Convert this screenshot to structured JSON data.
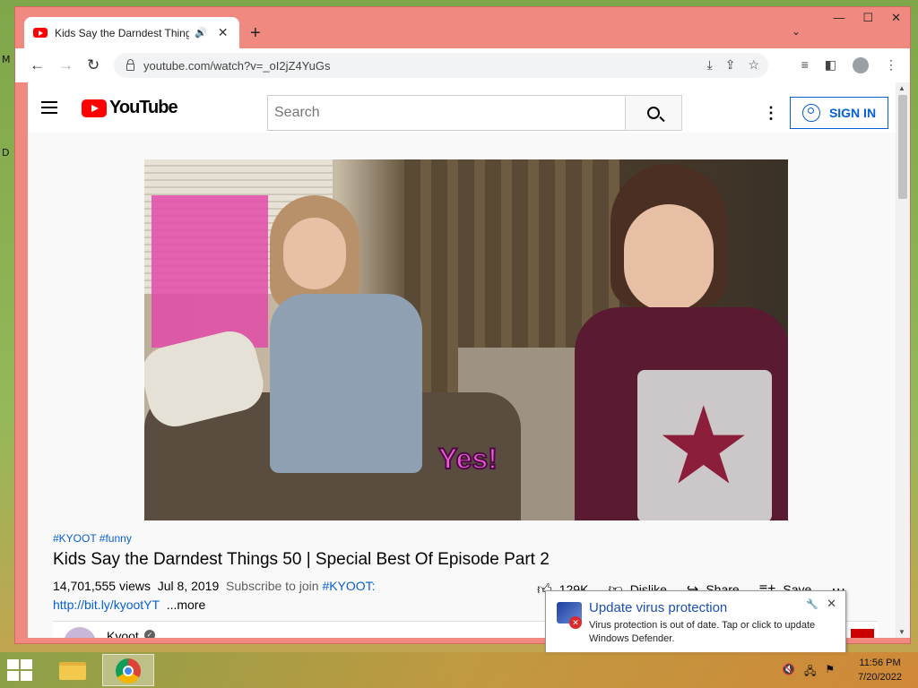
{
  "desktop": {
    "label_m": "M",
    "label_d": "D"
  },
  "browser": {
    "tab_title": "Kids Say the Darndest Things",
    "tab_close": "✕",
    "new_tab": "+",
    "url": "youtube.com/watch?v=_oI2jZ4YuGs",
    "window_controls": {
      "minimize": "—",
      "maximize": "☐",
      "close": "✕"
    }
  },
  "youtube": {
    "logo_text": "YouTube",
    "search_placeholder": "Search",
    "signin_label": "SIGN IN",
    "video_caption": "Yes!",
    "tags": "#KYOOT #funny",
    "title": "Kids Say the Darndest Things 50 | Special Best Of Episode Part 2",
    "views": "14,701,555 views",
    "date": "Jul 8, 2019",
    "subscribe_text": "Subscribe to join",
    "subscribe_link": "#KYOOT:",
    "desc_link": "http://bit.ly/kyootYT",
    "more": "...more",
    "actions": {
      "likes": "129K",
      "dislike": "Dislike",
      "share": "Share",
      "save": "Save"
    },
    "channel_name": "Kyoot"
  },
  "notification": {
    "title": "Update virus protection",
    "text": "Virus protection is out of date. Tap or click to update Windows Defender."
  },
  "taskbar": {
    "time": "11:56 PM",
    "date": "7/20/2022"
  }
}
